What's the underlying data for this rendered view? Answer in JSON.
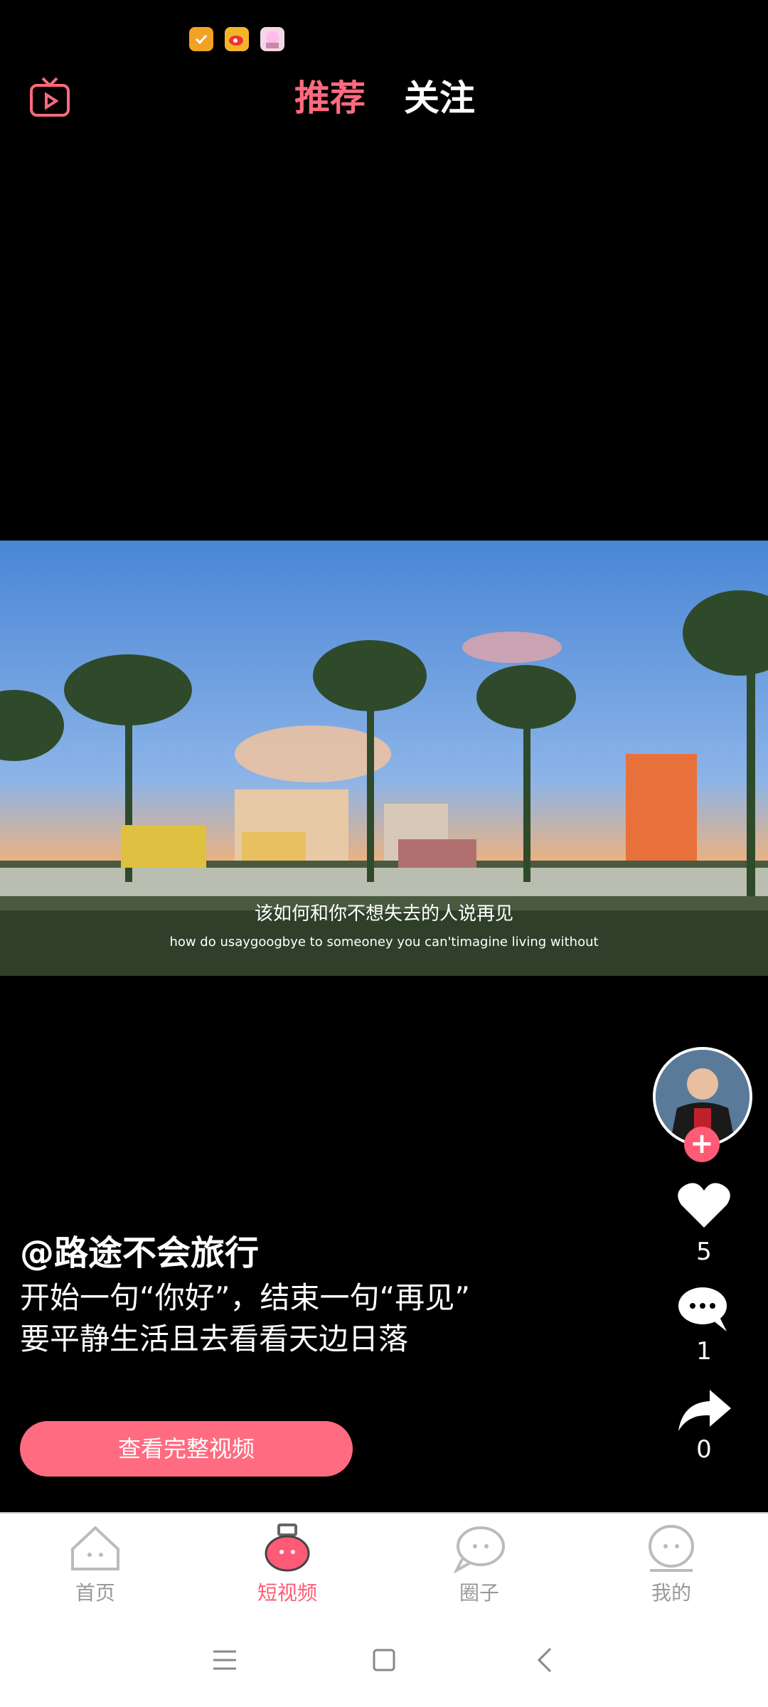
{
  "status_bar": {
    "notifications": [
      "check-badge-icon",
      "weibo-icon",
      "anime-avatar-icon"
    ]
  },
  "top_nav": {
    "tabs": [
      {
        "label": "推荐",
        "active": true
      },
      {
        "label": "关注",
        "active": false
      }
    ],
    "accent": "#ff6a7f"
  },
  "video": {
    "subtitle_zh": "该如何和你不想失去的人说再见",
    "subtitle_en": "how do usaygoogbye to someoney you can'timagine living without"
  },
  "right_rail": {
    "like_count": "5",
    "comment_count": "1",
    "share_count": "0"
  },
  "caption": {
    "author": "@路途不会旅行",
    "description": "开始一句“你好”，结束一句“再见”  要平静生活且去看看天边日落",
    "cta": "查看完整视频"
  },
  "tab_bar": {
    "items": [
      {
        "label": "首页",
        "icon": "home-icon"
      },
      {
        "label": "短视频",
        "icon": "short-video-icon",
        "active": true
      },
      {
        "label": "圈子",
        "icon": "circle-icon"
      },
      {
        "label": "我的",
        "icon": "profile-icon"
      }
    ]
  },
  "system_nav": [
    "menu-icon",
    "home-square-icon",
    "back-icon"
  ]
}
